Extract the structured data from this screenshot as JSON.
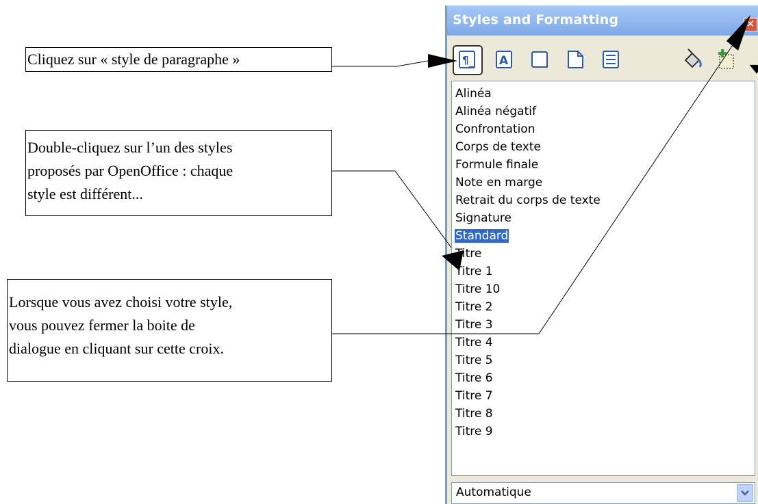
{
  "callouts": {
    "paragraph_style": [
      "Cliquez sur « style de paragraphe »"
    ],
    "double_click": [
      "Double-cliquez sur l’un des styles",
      "proposés par OpenOffice : chaque",
      "style est différent..."
    ],
    "close": [
      "Lorsque vous avez choisi votre style,",
      "vous pouvez fermer la boite de",
      "dialogue en cliquant sur cette croix."
    ]
  },
  "panel": {
    "title": "Styles and Formatting",
    "close_icon": "close-icon",
    "toolbar": {
      "buttons": [
        "paragraph-styles-icon",
        "character-styles-icon",
        "frame-styles-icon",
        "page-styles-icon",
        "list-styles-icon",
        "fill-format-icon",
        "new-style-icon",
        "chevron-down-icon"
      ]
    },
    "styles": [
      "Alinéa",
      "Alinéa négatif",
      "Confrontation",
      "Corps de texte",
      "Formule finale",
      "Note en marge",
      "Retrait du corps de texte",
      "Signature",
      "Standard",
      "Titre",
      "Titre 1",
      "Titre 10",
      "Titre 2",
      "Titre 3",
      "Titre 4",
      "Titre 5",
      "Titre 6",
      "Titre 7",
      "Titre 8",
      "Titre 9"
    ],
    "selected_style": "Standard",
    "filter": {
      "value": "Automatique"
    }
  },
  "colors": {
    "title_bar": "#8fb5ee",
    "selection": "#316ac5",
    "close_button": "#d9553a"
  }
}
